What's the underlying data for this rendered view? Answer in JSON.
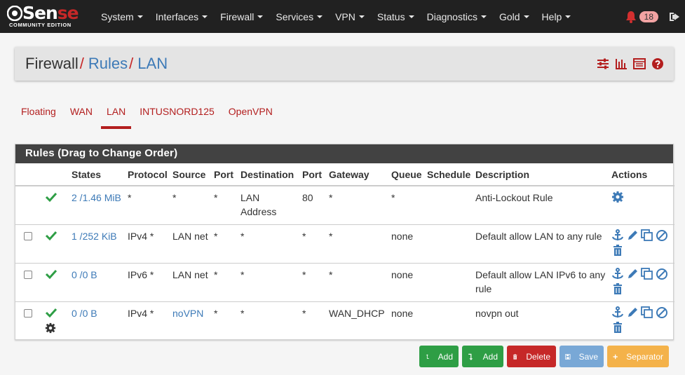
{
  "brand": {
    "name_part1": "Sen",
    "name_part2": "se",
    "edition": "COMMUNITY EDITION"
  },
  "nav": {
    "items": [
      "System",
      "Interfaces",
      "Firewall",
      "Services",
      "VPN",
      "Status",
      "Diagnostics",
      "Gold",
      "Help"
    ],
    "notifications_count": "18"
  },
  "breadcrumb": {
    "first": "Firewall",
    "second": "Rules",
    "third": "LAN",
    "separator": "/"
  },
  "tabs": [
    {
      "label": "Floating",
      "active": false
    },
    {
      "label": "WAN",
      "active": false
    },
    {
      "label": "LAN",
      "active": true
    },
    {
      "label": "INTUSNORD125",
      "active": false
    },
    {
      "label": "OpenVPN",
      "active": false
    }
  ],
  "rules_panel": {
    "title": "Rules (Drag to Change Order)",
    "headers": [
      "",
      "",
      "States",
      "Protocol",
      "Source",
      "Port",
      "Destination",
      "Port",
      "Gateway",
      "Queue",
      "Schedule",
      "Description",
      "Actions"
    ],
    "rows": [
      {
        "states": "2 /1.46 MiB",
        "protocol": "*",
        "source": "*",
        "src_port": "*",
        "destination": "LAN Address",
        "dst_port": "80",
        "gateway": "*",
        "queue": "*",
        "schedule": "",
        "description": "Anti-Lockout Rule"
      },
      {
        "states": "1 /252 KiB",
        "protocol": "IPv4 *",
        "source": "LAN net",
        "src_port": "*",
        "destination": "*",
        "dst_port": "*",
        "gateway": "*",
        "queue": "none",
        "schedule": "",
        "description": "Default allow LAN to any rule"
      },
      {
        "states": "0 /0 B",
        "protocol": "IPv6 *",
        "source": "LAN net",
        "src_port": "*",
        "destination": "*",
        "dst_port": "*",
        "gateway": "*",
        "queue": "none",
        "schedule": "",
        "description": "Default allow LAN IPv6 to any rule"
      },
      {
        "states": "0 /0 B",
        "protocol": "IPv4 *",
        "source": "noVPN",
        "src_port": "*",
        "destination": "*",
        "dst_port": "*",
        "gateway": "WAN_DHCP",
        "queue": "none",
        "schedule": "",
        "description": "novpn out"
      }
    ]
  },
  "buttons": {
    "add_top": "Add",
    "add_bottom": "Add",
    "delete": "Delete",
    "save": "Save",
    "separator": "Separator"
  },
  "colors": {
    "navbar": "#212121",
    "accent_red": "#b31e1e",
    "link_blue": "#3d7ab7",
    "check_green": "#2e9e45",
    "panel_head": "#424242"
  }
}
